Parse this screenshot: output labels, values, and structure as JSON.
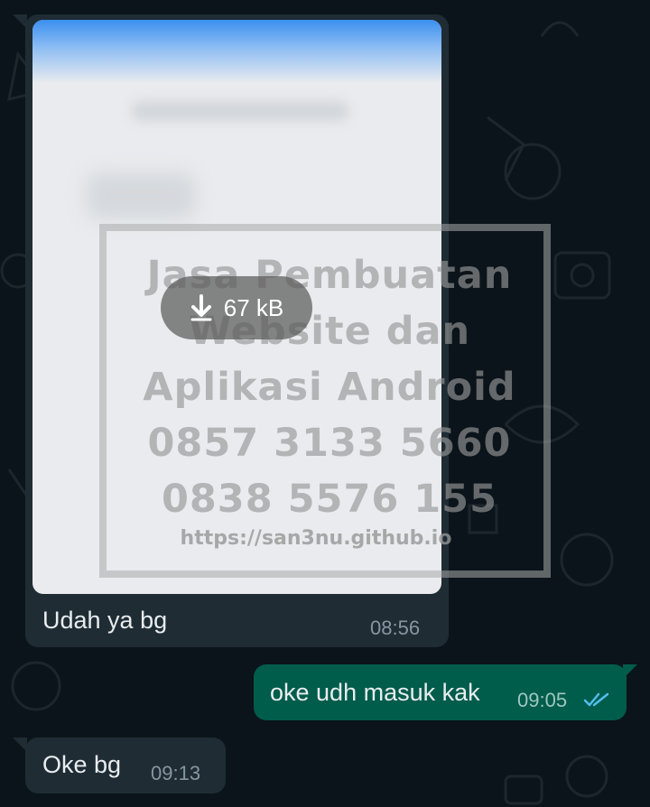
{
  "colors": {
    "background": "#0b141a",
    "incoming_bubble": "#1f2c34",
    "outgoing_bubble": "#005c4b",
    "message_text": "#e9edef",
    "timestamp_in": "#8696a0",
    "read_ticks": "#53bdeb"
  },
  "messages": [
    {
      "direction": "incoming",
      "type": "image",
      "image": {
        "download_size": "67 kB",
        "download_icon": "arrow-down-icon",
        "watermark_lines": [
          "Jasa Pembuatan",
          "Website dan",
          "Aplikasi Android",
          "0857 3133 5660",
          "0838 5576 155"
        ],
        "watermark_url": "https://san3nu.github.io"
      },
      "caption": "Udah ya bg",
      "time": "08:56"
    },
    {
      "direction": "outgoing",
      "type": "text",
      "text": "oke udh masuk kak",
      "time": "09:05",
      "status_icon": "double-check-read-icon"
    },
    {
      "direction": "incoming",
      "type": "text",
      "text": "Oke bg",
      "time": "09:13"
    }
  ]
}
